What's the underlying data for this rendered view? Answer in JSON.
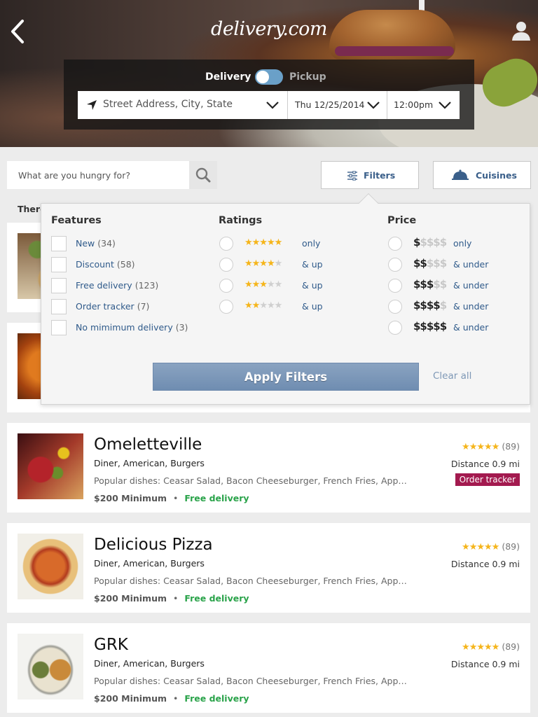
{
  "header": {
    "logo": "delivery.com",
    "mode_delivery": "Delivery",
    "mode_pickup": "Pickup",
    "address_placeholder": "Street Address, City, State",
    "date": "Thu 12/25/2014",
    "time": "12:00pm"
  },
  "search": {
    "placeholder": "What are you hungry for?",
    "filters_label": "Filters",
    "cuisines_label": "Cuisines"
  },
  "results_intro": "There",
  "filters": {
    "features_title": "Features",
    "features": [
      {
        "label": "New",
        "count": "(34)"
      },
      {
        "label": "Discount",
        "count": "(58)"
      },
      {
        "label": "Free delivery",
        "count": "(123)"
      },
      {
        "label": "Order tracker",
        "count": "(7)"
      },
      {
        "label": "No mimimum delivery",
        "count": "(3)"
      }
    ],
    "ratings_title": "Ratings",
    "ratings": [
      {
        "stars": 5,
        "suffix": "only"
      },
      {
        "stars": 4,
        "suffix": "& up"
      },
      {
        "stars": 3,
        "suffix": "& up"
      },
      {
        "stars": 2,
        "suffix": "& up"
      }
    ],
    "price_title": "Price",
    "prices": [
      {
        "level": 1,
        "suffix": "only"
      },
      {
        "level": 2,
        "suffix": "& under"
      },
      {
        "level": 3,
        "suffix": "& under"
      },
      {
        "level": 4,
        "suffix": "& under"
      },
      {
        "level": 5,
        "suffix": "& under"
      }
    ],
    "apply_label": "Apply Filters",
    "clear_label": "Clear all"
  },
  "restaurants": [
    {
      "name": "Omeletteville",
      "cuisine": "Diner, American, Burgers",
      "popular": "Popular dishes: Ceasar Salad, Bacon Cheeseburger, French Fries, Apple ...",
      "minimum": "$200 Minimum",
      "delivery": "Free delivery",
      "stars": "★★★★★",
      "reviews": "(89)",
      "distance": "Distance 0.9 mi",
      "badge": "Order tracker"
    },
    {
      "name": "Delicious Pizza",
      "cuisine": "Diner, American, Burgers",
      "popular": "Popular dishes: Ceasar Salad, Bacon Cheeseburger, French Fries, Apple ...",
      "minimum": "$200 Minimum",
      "delivery": "Free delivery",
      "stars": "★★★★★",
      "reviews": "(89)",
      "distance": "Distance 0.9 mi"
    },
    {
      "name": "GRK",
      "cuisine": "Diner, American, Burgers",
      "popular": "Popular dishes: Ceasar Salad, Bacon Cheeseburger, French Fries, Apple ...",
      "minimum": "$200 Minimum",
      "delivery": "Free delivery",
      "stars": "★★★★★",
      "reviews": "(89)",
      "distance": "Distance 0.9 mi"
    }
  ],
  "colors": {
    "accent": "#3a5f8a",
    "free_delivery": "#2aa34a",
    "tracker_badge": "#a31a4f",
    "stars": "#f5b51b"
  }
}
